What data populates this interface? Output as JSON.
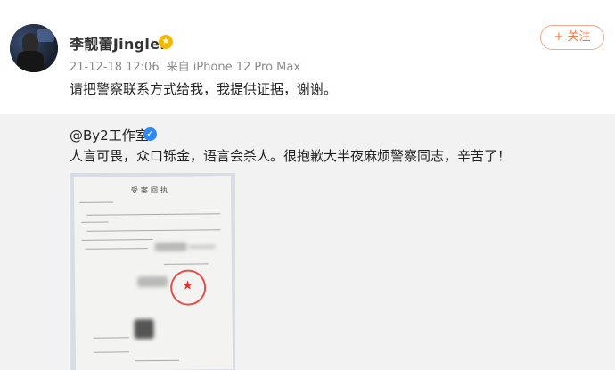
{
  "post": {
    "username": "李靓蕾Jinglei",
    "timestamp": "21-12-18 12:06",
    "source": "来自 iPhone 12 Pro Max",
    "text": "请把警察联系方式给我，我提供证据，谢谢。",
    "follow_label": "+ 关注",
    "badge_icon": "vip-badge-icon"
  },
  "repost": {
    "author": "@By2工作室",
    "text": "人言可畏，众口铄金，语言会杀人。很抱歉大半夜麻烦警察同志，辛苦了！",
    "image_description_icon": "document-photo"
  },
  "document": {
    "title": "受案回执"
  },
  "colors": {
    "accent_orange": "#f07540",
    "verified_blue": "#2f8af5",
    "vip_gold": "#f5b800",
    "repost_bg": "#f2f2f2"
  }
}
